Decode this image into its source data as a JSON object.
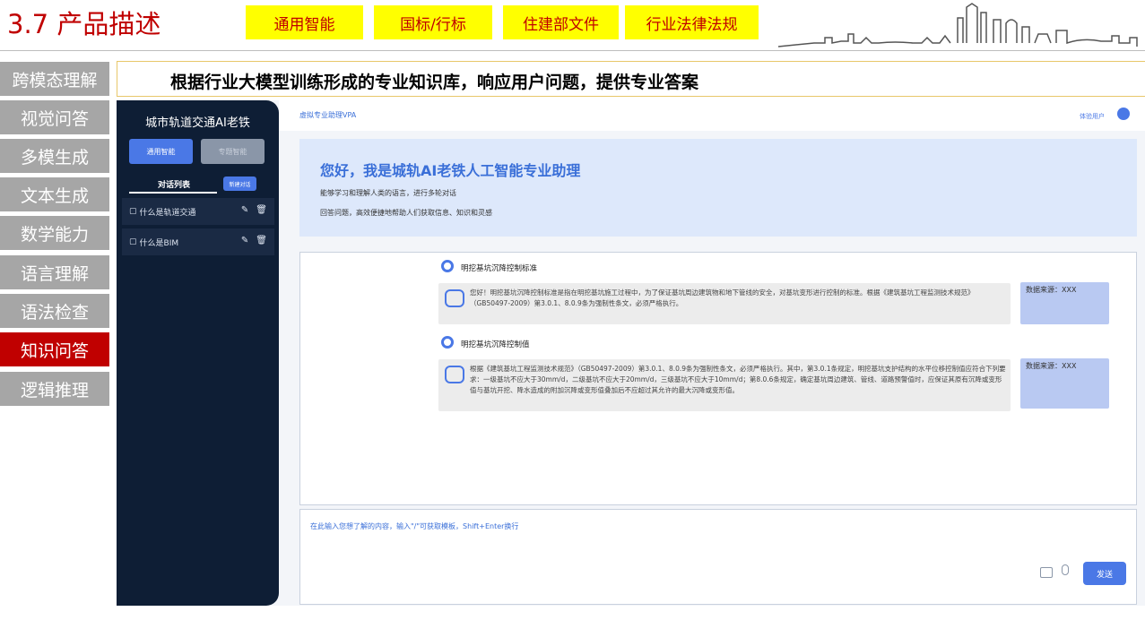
{
  "slide": {
    "title": "3.7 产品描述",
    "tags": [
      "通用智能",
      "国标/行标",
      "住建部文件",
      "行业法律法规"
    ],
    "categories": [
      "跨模态理解",
      "视觉问答",
      "多模生成",
      "文本生成",
      "数学能力",
      "语言理解",
      "语法检查",
      "知识问答",
      "逻辑推理"
    ],
    "active_category": "知识问答",
    "subtitle": "根据行业大模型训练形成的专业知识库，响应用户问题，提供专业答案"
  },
  "app": {
    "name": "城市轨道交通AI老铁",
    "mode_general": "通用智能",
    "mode_topic": "专题智能",
    "conversation_tab": "对话列表",
    "new_chat": "新建对话",
    "conversations": [
      "什么是轨道交通",
      "什么是BIM"
    ],
    "title": "虚拟专业助理VPA",
    "user_label": "体验用户",
    "welcome_title": "您好，我是城轨AI老铁人工智能专业助理",
    "welcome_line1": "能够学习和理解人类的语言，进行多轮对话",
    "welcome_line2": "回答问题，高效便捷地帮助人们获取信息、知识和灵感",
    "messages": [
      {
        "question": "明挖基坑沉降控制标准",
        "answer": "您好！明挖基坑沉降控制标准是指在明挖基坑施工过程中，为了保证基坑周边建筑物和地下管线的安全，对基坑变形进行控制的标准。根据《建筑基坑工程监测技术规范》（GB50497-2009）第3.0.1、8.0.9条为强制性条文，必须严格执行。",
        "source": "数据来源：XXX"
      },
      {
        "question": "明挖基坑沉降控制值",
        "answer": "根据《建筑基坑工程监测技术规范》（GB50497-2009）第3.0.1、8.0.9条为强制性条文，必须严格执行。其中，第3.0.1条规定，明挖基坑支护结构的水平位移控制值应符合下列要求：一级基坑不应大于30mm/d，二级基坑不应大于20mm/d，三级基坑不应大于10mm/d；第8.0.6条规定，确定基坑周边建筑、管线、道路预警值时，应保证其原有沉降或变形值与基坑开挖、降水造成的附加沉降或变形值叠加后不应超过其允许的最大沉降或变形值。",
        "source": "数据来源：XXX"
      }
    ],
    "input_placeholder": "在此输入您想了解的内容，输入\"/\"可获取模板，Shift+Enter换行",
    "send": "发送"
  },
  "colors": {
    "title_red": "#c00000",
    "tag_yellow": "#ffff00",
    "nav_gray": "#a6a6a6",
    "sidebar_navy": "#0e1e35",
    "accent_blue": "#4a78e6"
  },
  "icons": [
    "chat-bubble-icon",
    "edit-icon",
    "trash-icon",
    "user-avatar-icon",
    "bot-icon",
    "image-upload-icon",
    "microphone-icon"
  ]
}
